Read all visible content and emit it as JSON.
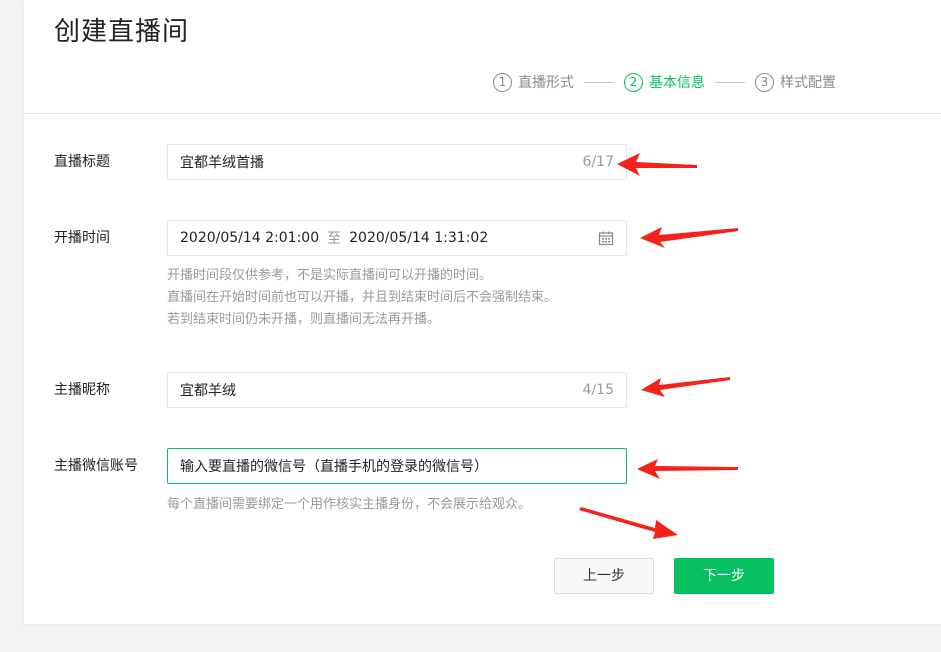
{
  "page": {
    "title": "创建直播间"
  },
  "steps": [
    {
      "num": "1",
      "label": "直播形式"
    },
    {
      "num": "2",
      "label": "基本信息"
    },
    {
      "num": "3",
      "label": "样式配置"
    }
  ],
  "form": {
    "title_field": {
      "label": "直播标题",
      "value": "宜都羊绒首播",
      "counter": "6/17"
    },
    "time_field": {
      "label": "开播时间",
      "start": "2020/05/14 2:01:00",
      "separator": "至",
      "end": "2020/05/14 1:31:02",
      "hints": [
        "开播时间段仅供参考，不是实际直播间可以开播的时间。",
        "直播间在开始时间前也可以开播，并且到结束时间后不会强制结束。",
        "若到结束时间仍未开播，则直播间无法再开播。"
      ]
    },
    "nickname_field": {
      "label": "主播昵称",
      "value": "宜都羊绒",
      "counter": "4/15"
    },
    "wechat_field": {
      "label": "主播微信账号",
      "placeholder": "输入要直播的微信号（直播手机的登录的微信号）",
      "hint": "每个直播间需要绑定一个用作核实主播身份，不会展示给观众。"
    }
  },
  "buttons": {
    "prev": "上一步",
    "next": "下一步"
  },
  "colors": {
    "accent": "#07c160",
    "annotation": "#f5221b",
    "muted": "#9a9a9a"
  }
}
